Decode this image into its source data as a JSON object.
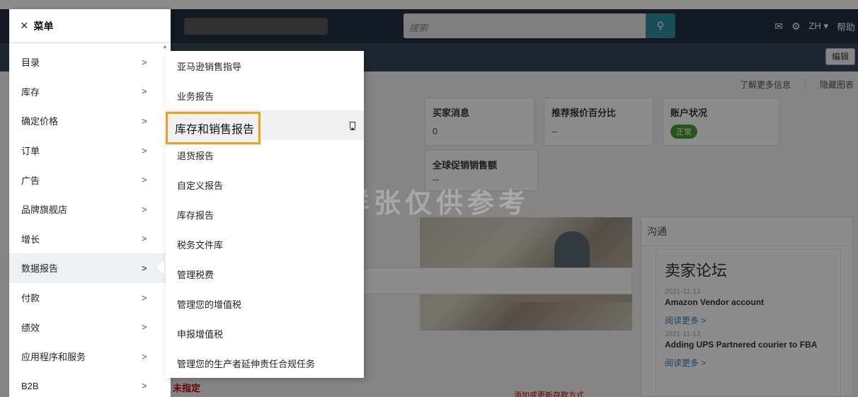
{
  "background": {
    "search_placeholder": "搜索",
    "lang": "ZH",
    "help": "帮助",
    "edit_label": "编辑",
    "learn_more": "了解更多信息",
    "hide_chart": "隐藏图表",
    "cards": [
      {
        "title": "买家消息",
        "value": "0"
      },
      {
        "title": "推荐报价百分比",
        "value": "--"
      },
      {
        "title": "账户状况",
        "badge": "正常"
      },
      {
        "title": "全球促销销售额",
        "value": "--"
      }
    ],
    "communication": {
      "title": "沟通",
      "forum_title": "卖家论坛",
      "posts": [
        {
          "date": "2021-11-13",
          "title": "Amazon Vendor account",
          "more": "阅读更多 >"
        },
        {
          "date": "2021-11-13",
          "title": "Adding UPS Partnered courier to FBA",
          "more": "阅读更多 >"
        }
      ]
    },
    "red_text": "未指定",
    "red_link": "添加或更新存款方式"
  },
  "menu": {
    "close_label": "×",
    "title": "菜单",
    "items": [
      "目录",
      "库存",
      "确定价格",
      "订单",
      "广告",
      "品牌旗舰店",
      "增长",
      "数据报告",
      "付款",
      "绩效",
      "应用程序和服务",
      "B2B"
    ],
    "active_index": 7
  },
  "submenu": {
    "items": [
      "亚马逊销售指导",
      "业务报告",
      "库存和销售报告",
      "退货报告",
      "自定义报告",
      "库存报告",
      "税务文件库",
      "管理税费",
      "管理您的增值税",
      "申报增值税",
      "管理您的生产者延伸责任合规任务"
    ],
    "highlight_index": 2
  },
  "watermark": "样张仅供参考",
  "colors": {
    "highlight_border": "#f0a01e",
    "topbar": "#232f3e",
    "status_green": "#4b9b2e"
  }
}
